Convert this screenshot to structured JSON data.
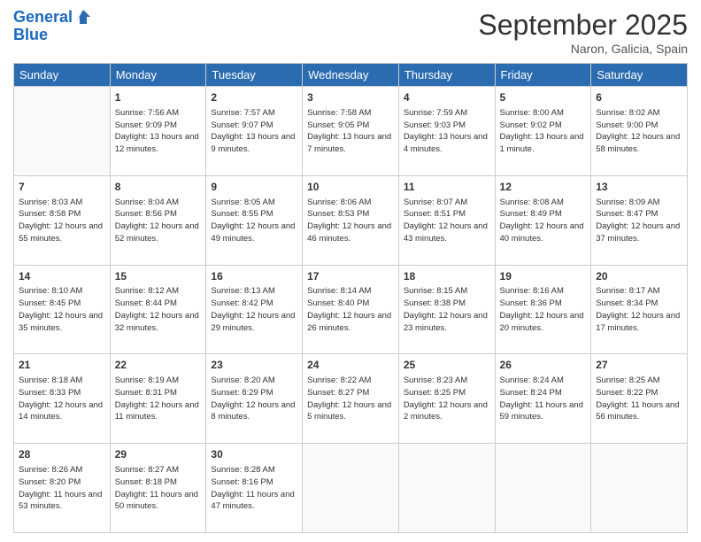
{
  "header": {
    "logo_line1": "General",
    "logo_line2": "Blue",
    "month": "September 2025",
    "location": "Naron, Galicia, Spain"
  },
  "days_of_week": [
    "Sunday",
    "Monday",
    "Tuesday",
    "Wednesday",
    "Thursday",
    "Friday",
    "Saturday"
  ],
  "weeks": [
    [
      {
        "day": "",
        "sunrise": "",
        "sunset": "",
        "daylight": ""
      },
      {
        "day": "1",
        "sunrise": "Sunrise: 7:56 AM",
        "sunset": "Sunset: 9:09 PM",
        "daylight": "Daylight: 13 hours and 12 minutes."
      },
      {
        "day": "2",
        "sunrise": "Sunrise: 7:57 AM",
        "sunset": "Sunset: 9:07 PM",
        "daylight": "Daylight: 13 hours and 9 minutes."
      },
      {
        "day": "3",
        "sunrise": "Sunrise: 7:58 AM",
        "sunset": "Sunset: 9:05 PM",
        "daylight": "Daylight: 13 hours and 7 minutes."
      },
      {
        "day": "4",
        "sunrise": "Sunrise: 7:59 AM",
        "sunset": "Sunset: 9:03 PM",
        "daylight": "Daylight: 13 hours and 4 minutes."
      },
      {
        "day": "5",
        "sunrise": "Sunrise: 8:00 AM",
        "sunset": "Sunset: 9:02 PM",
        "daylight": "Daylight: 13 hours and 1 minute."
      },
      {
        "day": "6",
        "sunrise": "Sunrise: 8:02 AM",
        "sunset": "Sunset: 9:00 PM",
        "daylight": "Daylight: 12 hours and 58 minutes."
      }
    ],
    [
      {
        "day": "7",
        "sunrise": "Sunrise: 8:03 AM",
        "sunset": "Sunset: 8:58 PM",
        "daylight": "Daylight: 12 hours and 55 minutes."
      },
      {
        "day": "8",
        "sunrise": "Sunrise: 8:04 AM",
        "sunset": "Sunset: 8:56 PM",
        "daylight": "Daylight: 12 hours and 52 minutes."
      },
      {
        "day": "9",
        "sunrise": "Sunrise: 8:05 AM",
        "sunset": "Sunset: 8:55 PM",
        "daylight": "Daylight: 12 hours and 49 minutes."
      },
      {
        "day": "10",
        "sunrise": "Sunrise: 8:06 AM",
        "sunset": "Sunset: 8:53 PM",
        "daylight": "Daylight: 12 hours and 46 minutes."
      },
      {
        "day": "11",
        "sunrise": "Sunrise: 8:07 AM",
        "sunset": "Sunset: 8:51 PM",
        "daylight": "Daylight: 12 hours and 43 minutes."
      },
      {
        "day": "12",
        "sunrise": "Sunrise: 8:08 AM",
        "sunset": "Sunset: 8:49 PM",
        "daylight": "Daylight: 12 hours and 40 minutes."
      },
      {
        "day": "13",
        "sunrise": "Sunrise: 8:09 AM",
        "sunset": "Sunset: 8:47 PM",
        "daylight": "Daylight: 12 hours and 37 minutes."
      }
    ],
    [
      {
        "day": "14",
        "sunrise": "Sunrise: 8:10 AM",
        "sunset": "Sunset: 8:45 PM",
        "daylight": "Daylight: 12 hours and 35 minutes."
      },
      {
        "day": "15",
        "sunrise": "Sunrise: 8:12 AM",
        "sunset": "Sunset: 8:44 PM",
        "daylight": "Daylight: 12 hours and 32 minutes."
      },
      {
        "day": "16",
        "sunrise": "Sunrise: 8:13 AM",
        "sunset": "Sunset: 8:42 PM",
        "daylight": "Daylight: 12 hours and 29 minutes."
      },
      {
        "day": "17",
        "sunrise": "Sunrise: 8:14 AM",
        "sunset": "Sunset: 8:40 PM",
        "daylight": "Daylight: 12 hours and 26 minutes."
      },
      {
        "day": "18",
        "sunrise": "Sunrise: 8:15 AM",
        "sunset": "Sunset: 8:38 PM",
        "daylight": "Daylight: 12 hours and 23 minutes."
      },
      {
        "day": "19",
        "sunrise": "Sunrise: 8:16 AM",
        "sunset": "Sunset: 8:36 PM",
        "daylight": "Daylight: 12 hours and 20 minutes."
      },
      {
        "day": "20",
        "sunrise": "Sunrise: 8:17 AM",
        "sunset": "Sunset: 8:34 PM",
        "daylight": "Daylight: 12 hours and 17 minutes."
      }
    ],
    [
      {
        "day": "21",
        "sunrise": "Sunrise: 8:18 AM",
        "sunset": "Sunset: 8:33 PM",
        "daylight": "Daylight: 12 hours and 14 minutes."
      },
      {
        "day": "22",
        "sunrise": "Sunrise: 8:19 AM",
        "sunset": "Sunset: 8:31 PM",
        "daylight": "Daylight: 12 hours and 11 minutes."
      },
      {
        "day": "23",
        "sunrise": "Sunrise: 8:20 AM",
        "sunset": "Sunset: 8:29 PM",
        "daylight": "Daylight: 12 hours and 8 minutes."
      },
      {
        "day": "24",
        "sunrise": "Sunrise: 8:22 AM",
        "sunset": "Sunset: 8:27 PM",
        "daylight": "Daylight: 12 hours and 5 minutes."
      },
      {
        "day": "25",
        "sunrise": "Sunrise: 8:23 AM",
        "sunset": "Sunset: 8:25 PM",
        "daylight": "Daylight: 12 hours and 2 minutes."
      },
      {
        "day": "26",
        "sunrise": "Sunrise: 8:24 AM",
        "sunset": "Sunset: 8:24 PM",
        "daylight": "Daylight: 11 hours and 59 minutes."
      },
      {
        "day": "27",
        "sunrise": "Sunrise: 8:25 AM",
        "sunset": "Sunset: 8:22 PM",
        "daylight": "Daylight: 11 hours and 56 minutes."
      }
    ],
    [
      {
        "day": "28",
        "sunrise": "Sunrise: 8:26 AM",
        "sunset": "Sunset: 8:20 PM",
        "daylight": "Daylight: 11 hours and 53 minutes."
      },
      {
        "day": "29",
        "sunrise": "Sunrise: 8:27 AM",
        "sunset": "Sunset: 8:18 PM",
        "daylight": "Daylight: 11 hours and 50 minutes."
      },
      {
        "day": "30",
        "sunrise": "Sunrise: 8:28 AM",
        "sunset": "Sunset: 8:16 PM",
        "daylight": "Daylight: 11 hours and 47 minutes."
      },
      {
        "day": "",
        "sunrise": "",
        "sunset": "",
        "daylight": ""
      },
      {
        "day": "",
        "sunrise": "",
        "sunset": "",
        "daylight": ""
      },
      {
        "day": "",
        "sunrise": "",
        "sunset": "",
        "daylight": ""
      },
      {
        "day": "",
        "sunrise": "",
        "sunset": "",
        "daylight": ""
      }
    ]
  ]
}
